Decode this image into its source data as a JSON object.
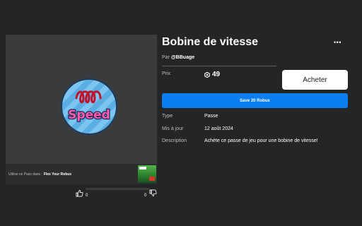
{
  "item": {
    "title": "Bobine de vitesse",
    "creator_prefix": "Par",
    "creator_name": "@BBuage",
    "price_label": "Prix",
    "price_value": "49",
    "buy_label": "Acheter",
    "save_label": "Save 20 Robux",
    "more_label": "•••",
    "type_label": "Type",
    "type_value": "Passe",
    "updated_label": "Mis à jour",
    "updated_value": "12 août 2024",
    "description_label": "Description",
    "description_value": "Achète ce passe de jeu pour une bobine de vitesse!"
  },
  "thumbnail": {
    "text": "Speed",
    "icon": "speed-coil-thumbnail"
  },
  "uses": {
    "label": "Utilise ce Pass dans :",
    "game": "Flex Your Robux",
    "icon": "game-thumbnail"
  },
  "votes": {
    "up_count": "0",
    "down_count": "0",
    "up_icon": "thumbs-up-icon",
    "down_icon": "thumbs-down-icon"
  },
  "colors": {
    "background": "#232527",
    "panel": "#393b3d",
    "accent_blue": "#0b7ff2",
    "buy_button": "#ffffff"
  }
}
